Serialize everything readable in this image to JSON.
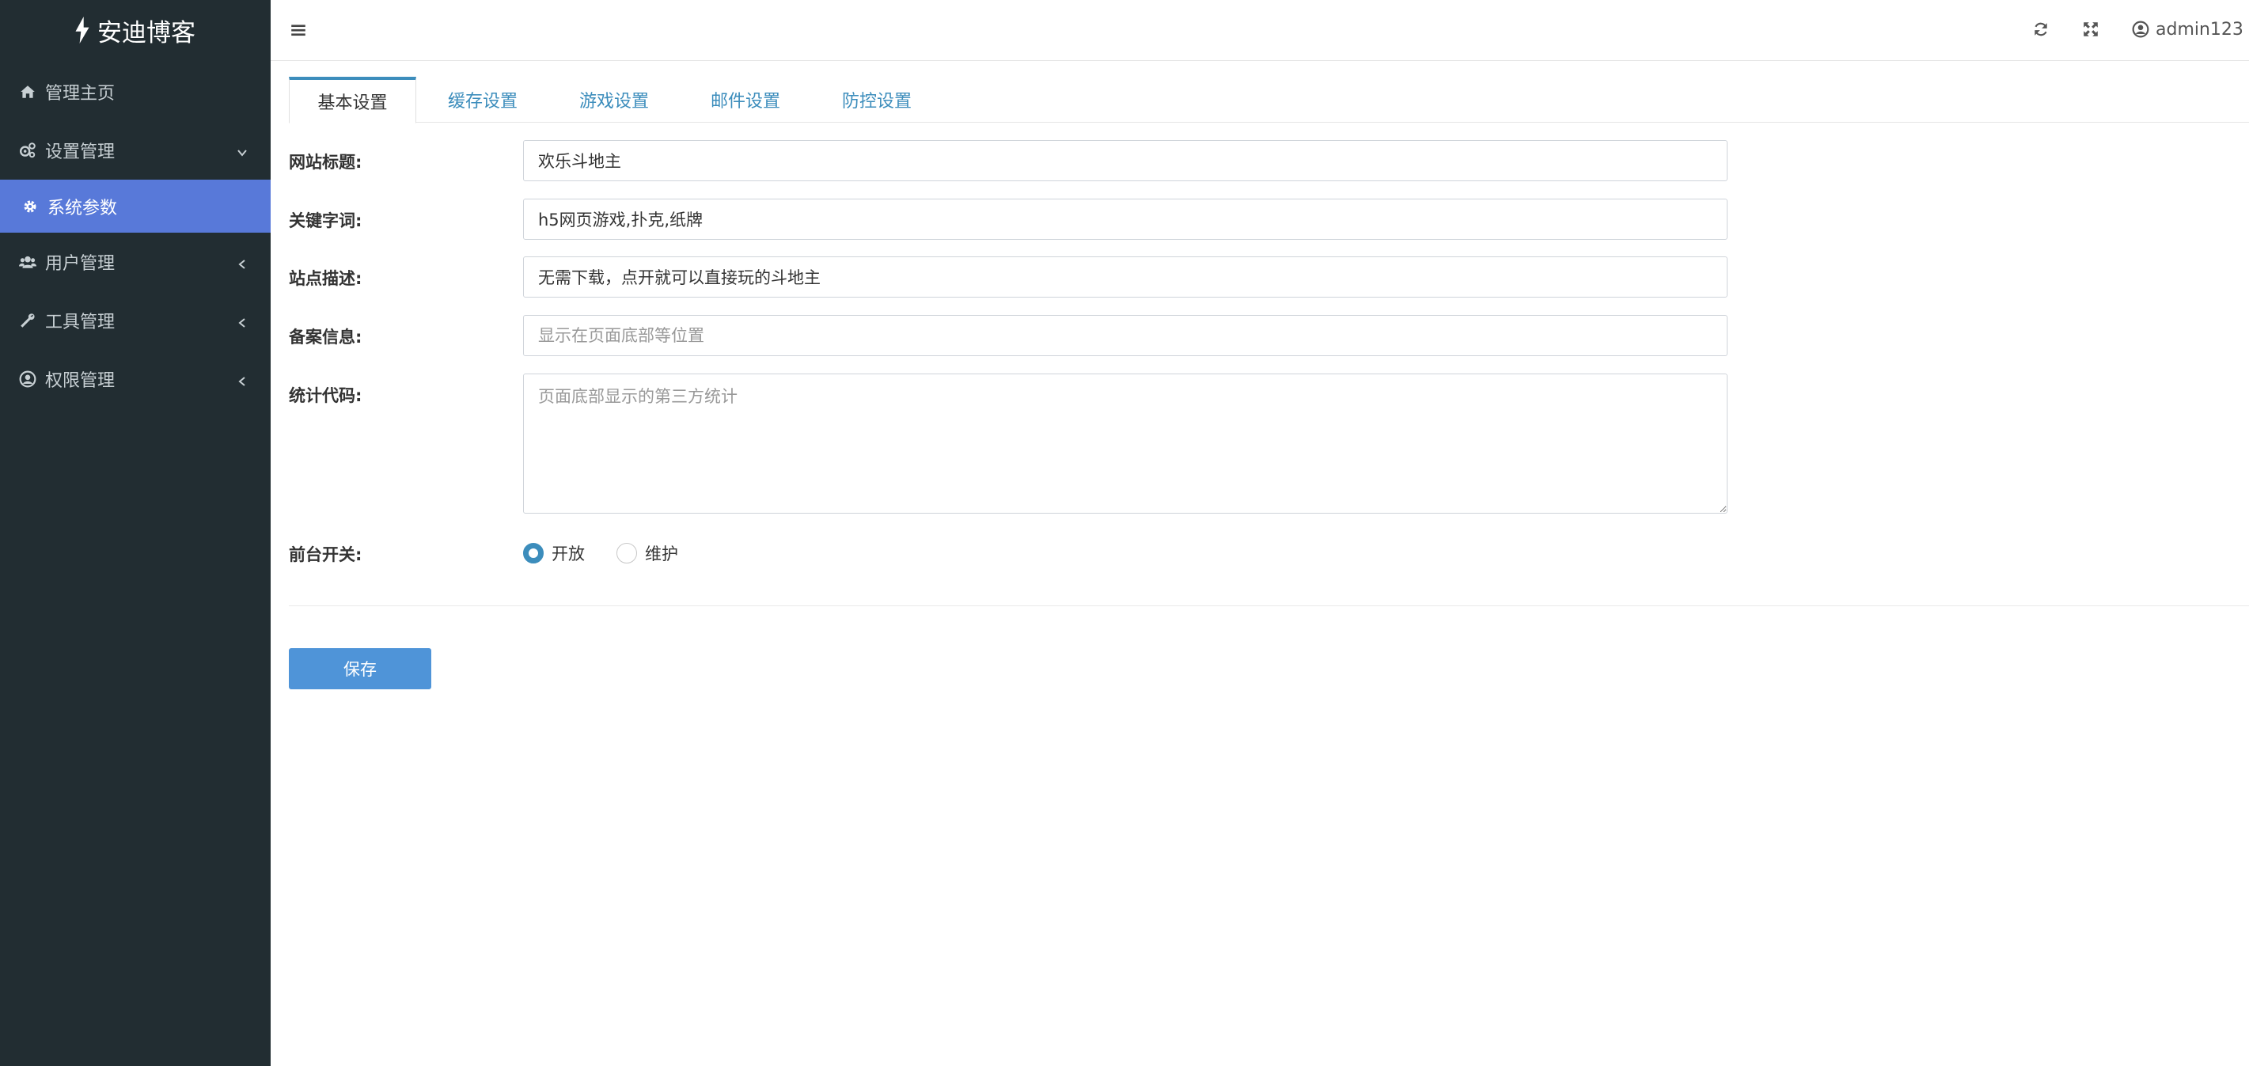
{
  "brand": {
    "name": "安迪博客",
    "icon": "bolt-icon"
  },
  "sidebar": {
    "items": [
      {
        "label": "管理主页",
        "icon": "home-icon"
      },
      {
        "label": "设置管理",
        "icon": "cogs-icon",
        "expanded": true,
        "children": [
          {
            "label": "系统参数",
            "icon": "gear-icon",
            "active": true
          }
        ]
      },
      {
        "label": "用户管理",
        "icon": "users-icon"
      },
      {
        "label": "工具管理",
        "icon": "wrench-icon"
      },
      {
        "label": "权限管理",
        "icon": "user-circle-icon"
      }
    ]
  },
  "header": {
    "username": "admin123",
    "icons": [
      "menu-icon",
      "refresh-icon",
      "expand-icon",
      "user-circle-icon",
      "caret-down-icon"
    ]
  },
  "tabs": [
    {
      "label": "基本设置",
      "active": true
    },
    {
      "label": "缓存设置"
    },
    {
      "label": "游戏设置"
    },
    {
      "label": "邮件设置"
    },
    {
      "label": "防控设置"
    }
  ],
  "form": {
    "site_title": {
      "label": "网站标题:",
      "value": "欢乐斗地主"
    },
    "keywords": {
      "label": "关键字词:",
      "value": "h5网页游戏,扑克,纸牌"
    },
    "description": {
      "label": "站点描述:",
      "value": "无需下载，点开就可以直接玩的斗地主"
    },
    "icp": {
      "label": "备案信息:",
      "value": "",
      "placeholder": "显示在页面底部等位置"
    },
    "stats_code": {
      "label": "统计代码:",
      "value": "",
      "placeholder": "页面底部显示的第三方统计"
    },
    "frontend_switch": {
      "label": "前台开关:",
      "options": [
        {
          "label": "开放",
          "checked": true
        },
        {
          "label": "维护",
          "checked": false
        }
      ]
    },
    "save_label": "保存"
  },
  "colors": {
    "sidebar_bg": "#222d32",
    "active_menu": "#5879d9",
    "accent": "#3c8dbc",
    "button": "#4f94d8"
  }
}
